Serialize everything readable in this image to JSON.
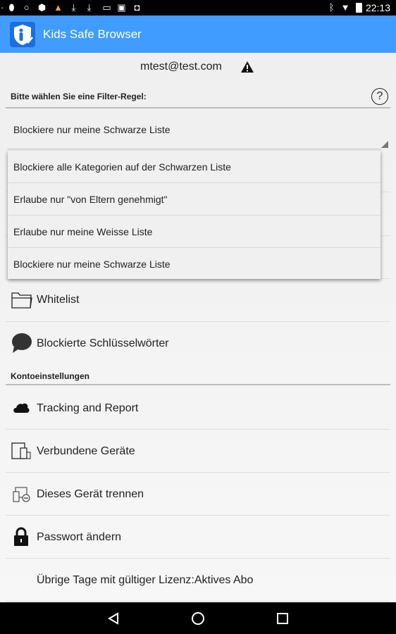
{
  "status_bar": {
    "time": "22:13",
    "icons": [
      "notification-dot",
      "keyhole-icon",
      "circle-icon",
      "android-icon",
      "warning-icon",
      "download-icon",
      "download-icon",
      "gamepad-icon",
      "clipboard-icon",
      "robot-icon",
      "bluetooth-icon",
      "wifi-icon",
      "battery-charging-icon"
    ],
    "warning_color": "#e8a33d"
  },
  "app_bar": {
    "title": "Kids Safe Browser",
    "color": "#409cff"
  },
  "account": {
    "email": "mtest@test.com"
  },
  "filter": {
    "label": "Bitte wählen Sie eine Filter-Regel:",
    "selected": "Blockiere nur meine Schwarze Liste",
    "options": [
      "Blockiere alle Kategorien auf der Schwarzen Liste",
      "Erlaube nur \"von Eltern genehmigt\"",
      "Erlaube nur meine Weisse Liste",
      "Blockiere nur meine Schwarze Liste"
    ]
  },
  "filter_items": [
    {
      "label": "Whitelist",
      "icon": "folder-icon"
    },
    {
      "label": "Blockierte Schlüsselwörter",
      "icon": "speech-bubble-icon"
    }
  ],
  "account_section": {
    "header": "Kontoeinstellungen",
    "items": [
      {
        "label": "Tracking and Report",
        "icon": "cloud-icon"
      },
      {
        "label": "Verbundene Geräte",
        "icon": "devices-icon"
      },
      {
        "label": "Dieses Gerät trennen",
        "icon": "device-remove-icon"
      },
      {
        "label": "Passwort ändern",
        "icon": "lock-icon"
      },
      {
        "label": "Übrige Tage mit gültiger Lizenz:Aktives Abo",
        "icon": ""
      }
    ]
  }
}
